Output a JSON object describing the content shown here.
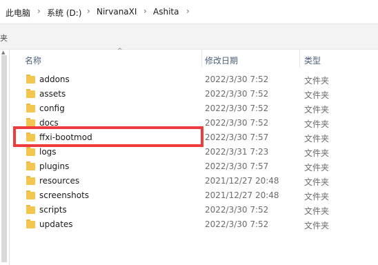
{
  "breadcrumb": {
    "items": [
      "此电脑",
      "系统 (D:)",
      "NirvanaXI",
      "Ashita"
    ],
    "separator": "›"
  },
  "left_pane": {
    "cut_text": "夹"
  },
  "columns": {
    "name": "名称",
    "modified": "修改日期",
    "type": "类型"
  },
  "files": [
    {
      "name": "addons",
      "modified": "2022/3/30 7:52",
      "type": "文件夹"
    },
    {
      "name": "assets",
      "modified": "2022/3/30 7:52",
      "type": "文件夹"
    },
    {
      "name": "config",
      "modified": "2022/3/30 7:52",
      "type": "文件夹"
    },
    {
      "name": "docs",
      "modified": "2022/3/30 7:52",
      "type": "文件夹"
    },
    {
      "name": "ffxi-bootmod",
      "modified": "2022/3/30 7:57",
      "type": "文件夹"
    },
    {
      "name": "logs",
      "modified": "2022/3/31 7:23",
      "type": "文件夹"
    },
    {
      "name": "plugins",
      "modified": "2022/3/30 7:57",
      "type": "文件夹"
    },
    {
      "name": "resources",
      "modified": "2021/12/27 20:48",
      "type": "文件夹"
    },
    {
      "name": "screenshots",
      "modified": "2021/12/27 20:48",
      "type": "文件夹"
    },
    {
      "name": "scripts",
      "modified": "2022/3/30 7:52",
      "type": "文件夹"
    },
    {
      "name": "updates",
      "modified": "2022/3/30 7:52",
      "type": "文件夹"
    }
  ],
  "highlight_color": "#ef3b3b",
  "folder_color": "#f4c64f",
  "icons": {
    "folder": "folder-icon",
    "sort": "sort-up-icon",
    "separator": "chevron-right-icon"
  }
}
